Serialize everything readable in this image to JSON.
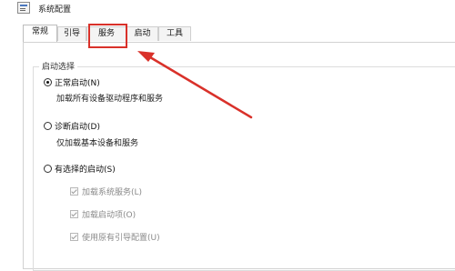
{
  "window": {
    "title": "系统配置"
  },
  "tabs": [
    {
      "label": "常规"
    },
    {
      "label": "引导"
    },
    {
      "label": "服务"
    },
    {
      "label": "启动"
    },
    {
      "label": "工具"
    }
  ],
  "startup_selection": {
    "legend": "启动选择",
    "normal": {
      "label": "正常启动(N)",
      "description": "加载所有设备驱动程序和服务"
    },
    "diagnostic": {
      "label": "诊断启动(D)",
      "description": "仅加载基本设备和服务"
    },
    "selective": {
      "label": "有选择的启动(S)",
      "options": [
        {
          "label": "加载系统服务(L)"
        },
        {
          "label": "加载启动项(O)"
        },
        {
          "label": "使用原有引导配置(U)"
        }
      ]
    }
  },
  "annotation": {
    "color": "#d9312a",
    "highlight_target": "tab-services"
  },
  "colors": {
    "accent_red": "#d9312a",
    "disabled_text": "#8a8a8a"
  }
}
